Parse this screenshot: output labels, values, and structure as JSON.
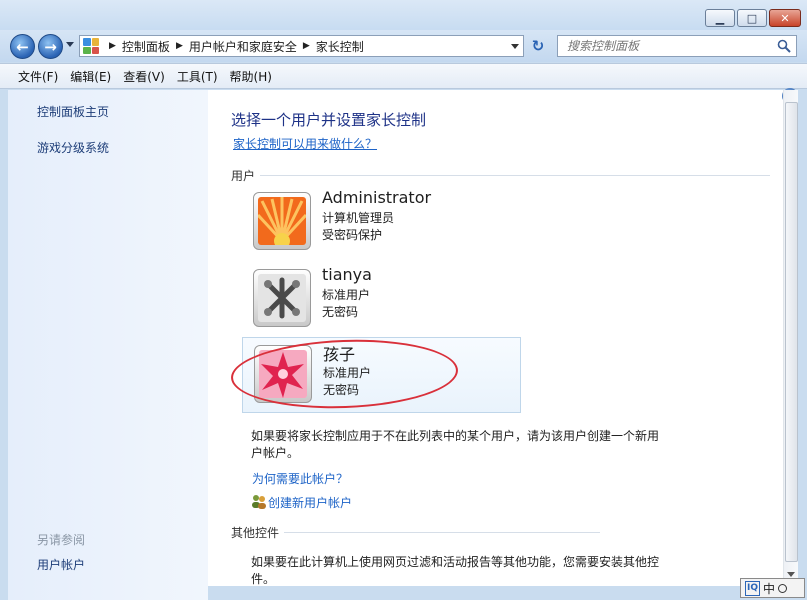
{
  "window": {
    "minimize_glyph": "▁",
    "maximize_glyph": "□",
    "close_glyph": "✕"
  },
  "nav": {
    "back_glyph": "←",
    "forward_glyph": "→",
    "breadcrumbs": [
      "控制面板",
      "用户帐户和家庭安全",
      "家长控制"
    ],
    "separator": "▶",
    "refresh_glyph": "↻",
    "search_placeholder": "搜索控制面板"
  },
  "menu": [
    "文件(F)",
    "编辑(E)",
    "查看(V)",
    "工具(T)",
    "帮助(H)"
  ],
  "sidebar": {
    "links": [
      "控制面板主页",
      "游戏分级系统"
    ],
    "see_also_heading": "另请参阅",
    "see_also_links": [
      "用户帐户"
    ]
  },
  "main": {
    "title": "选择一个用户并设置家长控制",
    "help_link": "家长控制可以用来做什么？",
    "users_label": "用户",
    "users": [
      {
        "name": "Administrator",
        "line1": "计算机管理员",
        "line2": "受密码保护",
        "avatar": "flower-orange"
      },
      {
        "name": "tianya",
        "line1": "标准用户",
        "line2": "无密码",
        "avatar": "metal-jacks"
      },
      {
        "name": "孩子",
        "line1": "标准用户",
        "line2": "无密码",
        "avatar": "star-pink"
      }
    ],
    "not_listed_text": "如果要将家长控制应用于不在此列表中的某个用户，请为该用户创建一个新用户帐户。",
    "why_link": "为何需要此帐户？",
    "create_link": "创建新用户帐户",
    "other_controls_label": "其他控件",
    "other_controls_text": "如果要在此计算机上使用网页过滤和活动报告等其他功能，您需要安装其他控件。"
  },
  "help_glyph": "?",
  "ime": {
    "label": "中",
    "logo": "IQ"
  },
  "colors": {
    "accent_link": "#1d63c7",
    "title_blue": "#1e3287",
    "annotation_red": "#d9303a",
    "sidebar_bg": "#e5eefb"
  }
}
